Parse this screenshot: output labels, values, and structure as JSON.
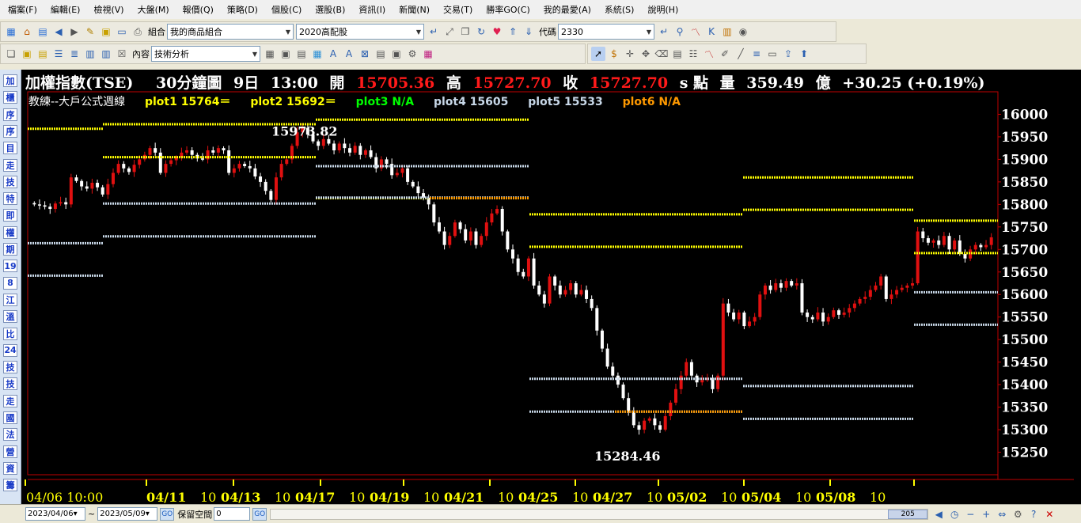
{
  "menu": [
    "檔案(F)",
    "編輯(E)",
    "檢視(V)",
    "大盤(M)",
    "報價(Q)",
    "策略(D)",
    "個股(C)",
    "選股(B)",
    "資訊(I)",
    "新聞(N)",
    "交易(T)",
    "勝率GO(C)",
    "我的最愛(A)",
    "系統(S)",
    "說明(H)"
  ],
  "toolbar1": {
    "group_label": "組合",
    "group_value": "我的商品組合",
    "portfolio_value": "2020高配股",
    "code_label": "代碼",
    "code_value": "2330"
  },
  "toolbar2": {
    "content_label": "內容",
    "content_value": "技術分析"
  },
  "left_buttons": [
    "加",
    "櫃",
    "序",
    "序",
    "目",
    "走",
    "技",
    "特",
    "即",
    "權",
    "期",
    "19",
    "8",
    "江",
    "溫",
    "比",
    "24",
    "技",
    "技",
    "走",
    "國",
    "法",
    "營",
    "資",
    "籌"
  ],
  "header": {
    "name": "加權指數(TSE)",
    "period": "30分鐘圖",
    "date": "9日",
    "time": "13:00",
    "open_label": "開",
    "open": "15705.36",
    "high_label": "高",
    "high": "15727.70",
    "close_label": "收",
    "close": "15727.70",
    "unit": "s 點",
    "vol_label": "量",
    "volume": "359.49",
    "vol_unit": "億",
    "change": "+30.25 (+0.19%)"
  },
  "plots": {
    "p0": "教練--大戶公式週線",
    "p1": "plot1 15764＝",
    "p2": "plot2 15692＝",
    "p3": "plot3 N/A",
    "p4": "plot4 15605",
    "p5": "plot5 15533",
    "p6": "plot6 N/A"
  },
  "colors": {
    "up": "#e01010",
    "down": "#ffffff",
    "yellow": "#ffff00",
    "orange": "#ff9900",
    "green": "#00ff00",
    "gray": "#c8d8e8",
    "axis": "#c00000"
  },
  "annotations": {
    "max": "15973.82",
    "min": "15284.46"
  },
  "statusbar": {
    "start_date": "2023/04/06",
    "tilde": "~",
    "end_date": "2023/05/09",
    "go": "GO",
    "reserve_label": "保留空間",
    "reserve_value": "0",
    "scroll_value": "205"
  },
  "chart_data": {
    "type": "candlestick",
    "ylim": [
      15200,
      16050
    ],
    "y_ticks": [
      "16000",
      "15950",
      "15900",
      "15850",
      "15800",
      "15750",
      "15700",
      "15650",
      "15600",
      "15550",
      "15500",
      "15450",
      "15400",
      "15350",
      "15300",
      "15250"
    ],
    "x_labels": [
      {
        "text": "04/06 10:00",
        "bold": false
      },
      {
        "text": "04/11",
        "bold": true
      },
      {
        "text": "10",
        "bold": false
      },
      {
        "text": "04/13",
        "bold": true
      },
      {
        "text": "10",
        "bold": false
      },
      {
        "text": "04/17",
        "bold": true
      },
      {
        "text": "10",
        "bold": false
      },
      {
        "text": "04/19",
        "bold": true
      },
      {
        "text": "10",
        "bold": false
      },
      {
        "text": "04/21",
        "bold": true
      },
      {
        "text": "10",
        "bold": false
      },
      {
        "text": "04/25",
        "bold": true
      },
      {
        "text": "10",
        "bold": false
      },
      {
        "text": "04/27",
        "bold": true
      },
      {
        "text": "10",
        "bold": false
      },
      {
        "text": "05/02",
        "bold": true
      },
      {
        "text": "10",
        "bold": false
      },
      {
        "text": "05/04",
        "bold": true
      },
      {
        "text": "10",
        "bold": false
      },
      {
        "text": "05/08",
        "bold": true
      },
      {
        "text": "10",
        "bold": false
      }
    ],
    "series_close": [
      15800,
      15798,
      15795,
      15790,
      15802,
      15805,
      15800,
      15860,
      15852,
      15840,
      15835,
      15848,
      15838,
      15822,
      15845,
      15870,
      15890,
      15880,
      15872,
      15888,
      15900,
      15910,
      15925,
      15915,
      15870,
      15890,
      15898,
      15905,
      15915,
      15920,
      15910,
      15902,
      15900,
      15920,
      15915,
      15925,
      15920,
      15870,
      15880,
      15890,
      15885,
      15880,
      15862,
      15850,
      15830,
      15810,
      15860,
      15890,
      15900,
      15930,
      15960,
      15970,
      15955,
      15940,
      15930,
      15945,
      15935,
      15920,
      15935,
      15925,
      15915,
      15930,
      15910,
      15920,
      15905,
      15880,
      15900,
      15890,
      15865,
      15870,
      15880,
      15850,
      15840,
      15825,
      15815,
      15800,
      15760,
      15740,
      15710,
      15730,
      15760,
      15745,
      15720,
      15740,
      15710,
      15730,
      15760,
      15780,
      15790,
      15740,
      15700,
      15680,
      15650,
      15640,
      15680,
      15620,
      15600,
      15580,
      15640,
      15620,
      15600,
      15610,
      15625,
      15600,
      15610,
      15590,
      15570,
      15520,
      15480,
      15440,
      15420,
      15400,
      15370,
      15340,
      15310,
      15300,
      15320,
      15325,
      15310,
      15300,
      15330,
      15360,
      15390,
      15420,
      15450,
      15420,
      15405,
      15410,
      15415,
      15390,
      15420,
      15580,
      15560,
      15545,
      15560,
      15530,
      15540,
      15550,
      15600,
      15620,
      15610,
      15625,
      15615,
      15630,
      15620,
      15625,
      15560,
      15550,
      15545,
      15560,
      15540,
      15550,
      15565,
      15555,
      15560,
      15570,
      15580,
      15590,
      15595,
      15610,
      15620,
      15640,
      15590,
      15600,
      15610,
      15615,
      15620,
      15625,
      15740,
      15725,
      15715,
      15720,
      15710,
      15730,
      15700,
      15720,
      15690,
      15680,
      15700,
      15710,
      15705,
      15710,
      15727
    ]
  }
}
